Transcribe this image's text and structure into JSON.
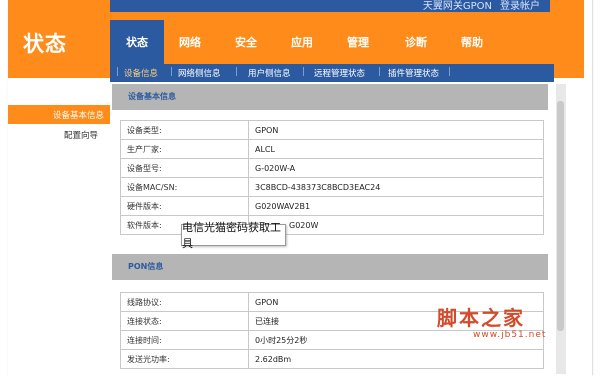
{
  "header": {
    "title": "状态",
    "top_strip_text": "天翼网关GPON",
    "top_strip_text2": "登录帐户"
  },
  "nav": {
    "tabs": [
      {
        "label": "状态",
        "active": true
      },
      {
        "label": "网络"
      },
      {
        "label": "安全"
      },
      {
        "label": "应用"
      },
      {
        "label": "管理"
      },
      {
        "label": "诊断"
      },
      {
        "label": "帮助"
      }
    ]
  },
  "subnav": {
    "items": [
      {
        "label": "设备信息",
        "active": true
      },
      {
        "label": "网络侧信息"
      },
      {
        "label": "用户侧信息"
      },
      {
        "label": "远程管理状态"
      },
      {
        "label": "插件管理状态"
      }
    ]
  },
  "sidebar": {
    "items": [
      {
        "label": "设备基本信息",
        "active": true
      },
      {
        "label": "配置向导"
      }
    ]
  },
  "device_section": {
    "heading": "设备基本信息",
    "rows": [
      {
        "key": "设备类型:",
        "value": "GPON"
      },
      {
        "key": "生产厂家:",
        "value": "ALCL"
      },
      {
        "key": "设备型号:",
        "value": "G-020W-A"
      },
      {
        "key": "设备MAC/SN:",
        "value": "3C8BCD-438373C8BCD3EAC24"
      },
      {
        "key": "硬件版本:",
        "value": "G020WAV2B1"
      },
      {
        "key": "软件版本:",
        "value": "G020W"
      }
    ]
  },
  "pon_section": {
    "heading": "PON信息",
    "rows": [
      {
        "key": "线路协议:",
        "value": "GPON"
      },
      {
        "key": "连接状态:",
        "value": "已连接"
      },
      {
        "key": "连接时间:",
        "value": "0小时25分2秒"
      },
      {
        "key": "发送光功率:",
        "value": "2.62dBm"
      }
    ]
  },
  "tooltip": {
    "text": "电信光猫密码获取工具"
  },
  "watermark": {
    "main": "脚本之家",
    "url": "www.jb51.net"
  },
  "colors": {
    "orange": "#ff8c1a",
    "blue": "#2c5aa0",
    "section_gray": "#b5b5b5"
  }
}
